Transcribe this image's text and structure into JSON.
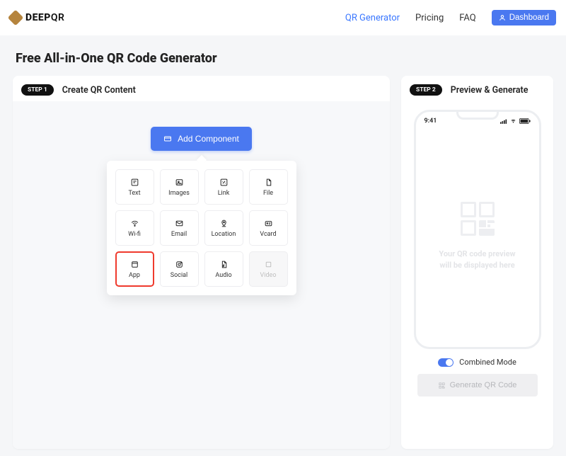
{
  "header": {
    "brand_prefix": "DEEP",
    "brand_suffix": "QR",
    "nav": {
      "qr_generator": "QR Generator",
      "pricing": "Pricing",
      "faq": "FAQ"
    },
    "dashboard_btn": "Dashboard"
  },
  "page_title": "Free All-in-One QR Code Generator",
  "left": {
    "step_label": "STEP 1",
    "title": "Create QR Content",
    "add_btn": "Add Component",
    "components": [
      {
        "key": "text",
        "label": "Text",
        "icon": "text-icon"
      },
      {
        "key": "images",
        "label": "Images",
        "icon": "image-icon"
      },
      {
        "key": "link",
        "label": "Link",
        "icon": "link-icon"
      },
      {
        "key": "file",
        "label": "File",
        "icon": "file-icon"
      },
      {
        "key": "wifi",
        "label": "Wi-fi",
        "icon": "wifi-icon"
      },
      {
        "key": "email",
        "label": "Email",
        "icon": "email-icon"
      },
      {
        "key": "location",
        "label": "Location",
        "icon": "location-icon"
      },
      {
        "key": "vcard",
        "label": "Vcard",
        "icon": "vcard-icon"
      },
      {
        "key": "app",
        "label": "App",
        "icon": "app-icon",
        "selected": true
      },
      {
        "key": "social",
        "label": "Social",
        "icon": "social-icon"
      },
      {
        "key": "audio",
        "label": "Audio",
        "icon": "audio-icon"
      },
      {
        "key": "video",
        "label": "Video",
        "icon": "video-icon",
        "disabled": true
      }
    ]
  },
  "right": {
    "step_label": "STEP 2",
    "title": "Preview & Generate",
    "status_time": "9:41",
    "placeholder_l1": "Your QR code preview",
    "placeholder_l2": "will be displayed here",
    "toggle_label": "Combined Mode",
    "generate_btn": "Generate QR Code"
  }
}
